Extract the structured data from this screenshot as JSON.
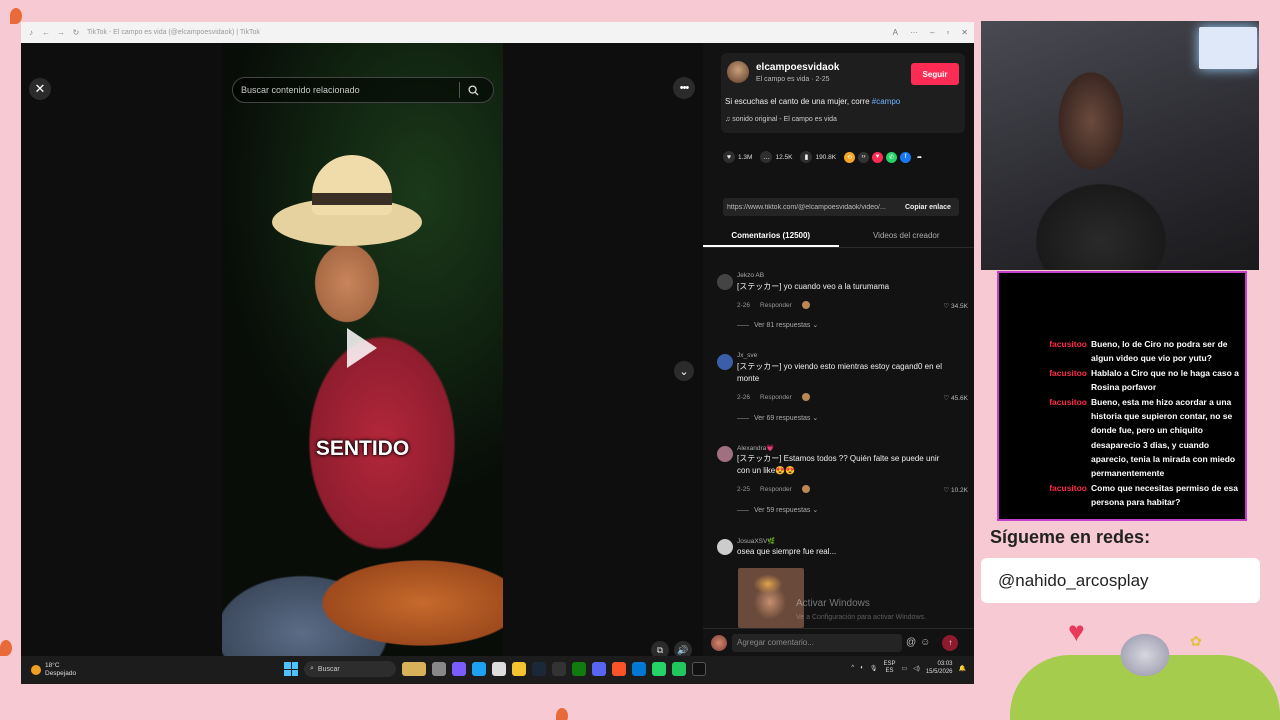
{
  "browser": {
    "title": "TikTok - El campo es vida (@elcampoesvidaok) | TikTok"
  },
  "video": {
    "search_placeholder": "Buscar contenido relacionado",
    "caption": "SENTIDO"
  },
  "creator": {
    "username": "elcampoesvidaok",
    "subtitle": "El campo es vida · 2-25",
    "follow_label": "Seguir",
    "description": "Si escuchas el canto de una mujer, corre ",
    "hashtag": "#campo",
    "sound": "sonido original - El campo es vida"
  },
  "stats": {
    "likes": "1.3M",
    "comments": "12.5K",
    "saves": "190.8K"
  },
  "share_icons": [
    {
      "name": "repost-icon",
      "glyph": "⟲",
      "color": "#f5a623"
    },
    {
      "name": "embed-icon",
      "glyph": "‹›",
      "color": "#333333"
    },
    {
      "name": "friends-icon",
      "glyph": "▼",
      "color": "#fe2c55"
    },
    {
      "name": "whatsapp-icon",
      "glyph": "✆",
      "color": "#25d366"
    },
    {
      "name": "facebook-icon",
      "glyph": "f",
      "color": "#1877f2"
    },
    {
      "name": "share-arrow-icon",
      "glyph": "➦",
      "color": "#121212"
    }
  ],
  "link": {
    "url": "https://www.tiktok.com/@elcampoesvidaok/video/...",
    "copy_label": "Copiar enlace"
  },
  "tabs": {
    "comments": "Comentarios (12500)",
    "creator_videos": "Videos del creador"
  },
  "comments": [
    {
      "user": "Jekzo AB",
      "text": "[ステッカー] yo cuando veo a la turumama",
      "date": "2-26",
      "reply": "Responder",
      "likes": "34.5K",
      "replies": "Ver 81 respuestas ⌄",
      "avatar_color": "#444444"
    },
    {
      "user": "Jx_sve",
      "text": "[ステッカー] yo viendo esto mientras estoy cagand0 en el monte",
      "date": "2-26",
      "reply": "Responder",
      "likes": "45.6K",
      "replies": "Ver 69 respuestas ⌄",
      "avatar_color": "#3a5ea8"
    },
    {
      "user": "Alexandra💗",
      "text": "[ステッカー] Estamos todos ?? Quién falte se puede unir con un like😍😍",
      "date": "2-25",
      "reply": "Responder",
      "likes": "10.2K",
      "replies": "Ver 59 respuestas ⌄",
      "avatar_color": "#a07080"
    },
    {
      "user": "JosuaXSV🌿",
      "text": "osea que siempre fue real...",
      "avatar_color": "#cccccc"
    }
  ],
  "comment_input": {
    "placeholder": "Agregar comentario..."
  },
  "windows_watermark": {
    "title": "Activar Windows",
    "subtitle": "Ve a Configuración para activar Windows."
  },
  "taskbar": {
    "temperature": "18°C",
    "weather": "Despejado",
    "search": "Buscar",
    "lang": "ESP",
    "lang2": "ES",
    "time": "03:03",
    "date": "15/5/2026"
  },
  "chat": [
    {
      "user": "facusitoo",
      "message": "Bueno, lo de Ciro no podra ser de algun video que vio por yutu?"
    },
    {
      "user": "facusitoo",
      "message": "Hablalo a Ciro que no le haga caso a Rosina porfavor"
    },
    {
      "user": "facusitoo",
      "message": "Bueno, esta me hizo acordar a una historia que supieron contar, no se donde fue, pero un chiquito desaparecio 3 dias, y cuando aparecio, tenia la mirada con miedo permanentemente"
    },
    {
      "user": "facusitoo",
      "message": "Como que necesitas permiso de esa persona para habitar?"
    }
  ],
  "socials": {
    "label": "Sígueme en redes:",
    "handle": "@nahido_arcosplay"
  }
}
